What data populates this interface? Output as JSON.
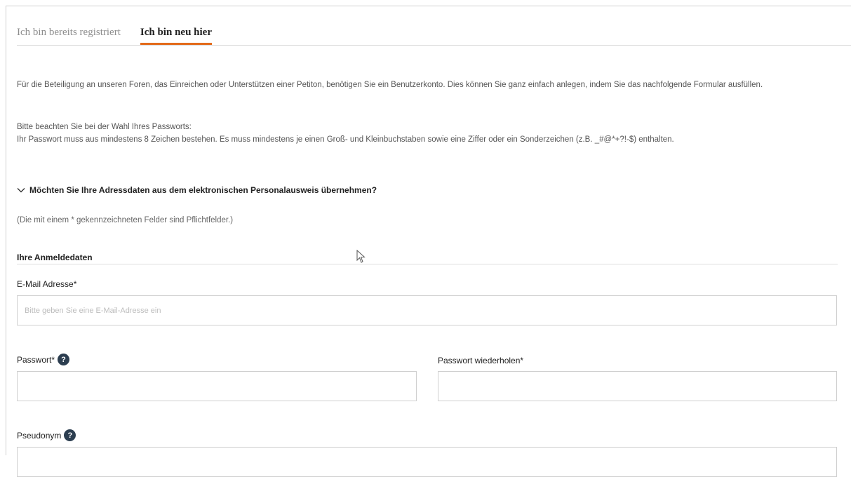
{
  "tabs": {
    "registered": "Ich bin bereits registriert",
    "new": "Ich bin neu hier"
  },
  "intro": "Für die Beteiligung an unseren Foren, das Einreichen oder Unterstützen einer Petiton, benötigen Sie ein Benutzerkonto. Dies können Sie ganz einfach anlegen, indem Sie das nachfolgende Formular ausfüllen.",
  "password_note_title": "Bitte beachten Sie bei der Wahl Ihres Passworts:",
  "password_note_text": "Ihr Passwort muss aus mindestens 8 Zeichen bestehen. Es muss mindestens je einen Groß- und Kleinbuchstaben sowie eine Ziffer oder ein Sonderzeichen (z.B. _#@*+?!-$) enthalten.",
  "id_card_toggle": "Möchten Sie Ihre Adressdaten aus dem elektronischen Personalausweis übernehmen?",
  "required_hint": "(Die mit einem * gekennzeichneten Felder sind Pflichtfelder.)",
  "section_title": "Ihre Anmeldedaten",
  "fields": {
    "email_label": "E-Mail Adresse*",
    "email_placeholder": "Bitte geben Sie eine E-Mail-Adresse ein",
    "password_label": "Passwort*",
    "password_repeat_label": "Passwort wiederholen*",
    "pseudonym_label": "Pseudonym"
  },
  "icons": {
    "help": "?"
  },
  "colors": {
    "accent": "#e36a1a",
    "help_icon": "#2c3e50"
  }
}
